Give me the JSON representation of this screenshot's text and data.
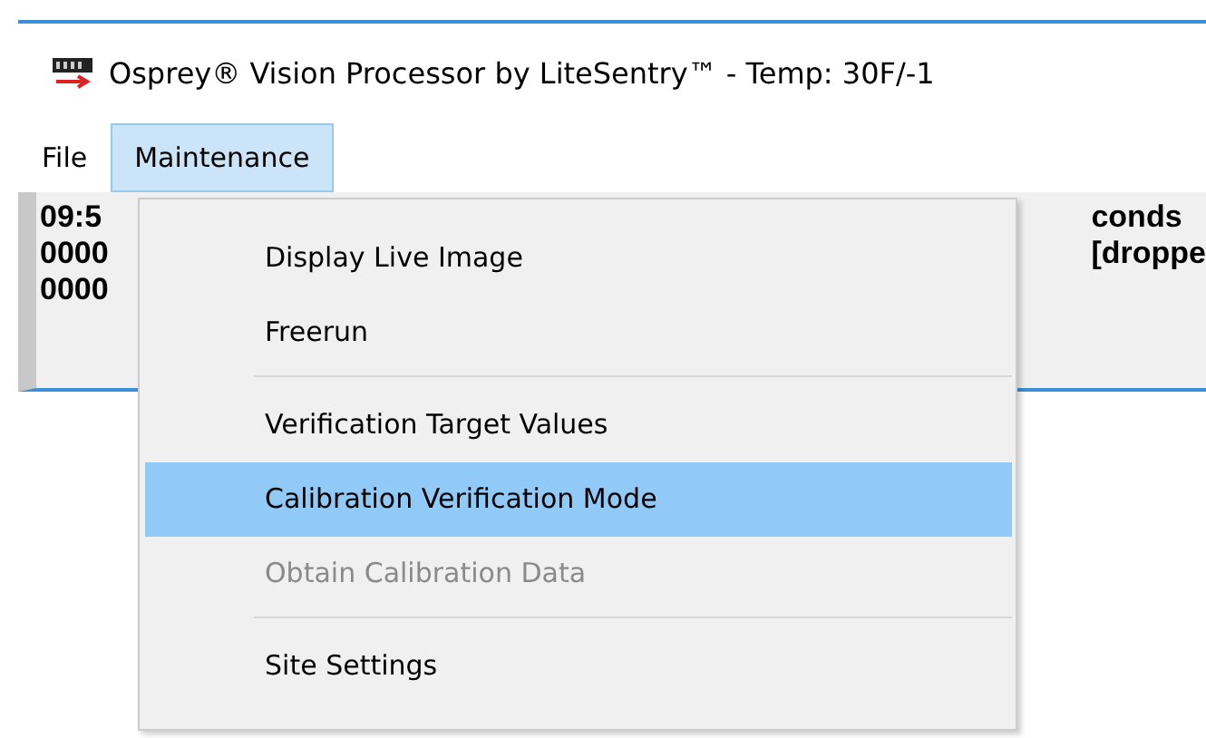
{
  "window": {
    "title": "Osprey® Vision Processor by LiteSentry™ - Temp: 30F/-1"
  },
  "menu_bar": [
    {
      "label": "File",
      "selected": false
    },
    {
      "label": "Maintenance",
      "selected": true
    }
  ],
  "status_panel": {
    "left_lines": [
      "09:5",
      "0000",
      "0000"
    ],
    "right_lines": [
      "conds",
      "[droppe"
    ]
  },
  "menu": [
    {
      "kind": "item",
      "label": "Display Live Image",
      "selected": false,
      "disabled": false
    },
    {
      "kind": "item",
      "label": "Freerun",
      "selected": false,
      "disabled": false
    },
    {
      "kind": "separator"
    },
    {
      "kind": "item",
      "label": "Verification Target Values",
      "selected": false,
      "disabled": false
    },
    {
      "kind": "item",
      "label": "Calibration Verification Mode",
      "selected": true,
      "disabled": false
    },
    {
      "kind": "item",
      "label": "Obtain Calibration Data",
      "selected": false,
      "disabled": true
    },
    {
      "kind": "separator"
    },
    {
      "kind": "item",
      "label": "Site Settings",
      "selected": false,
      "disabled": false
    }
  ]
}
